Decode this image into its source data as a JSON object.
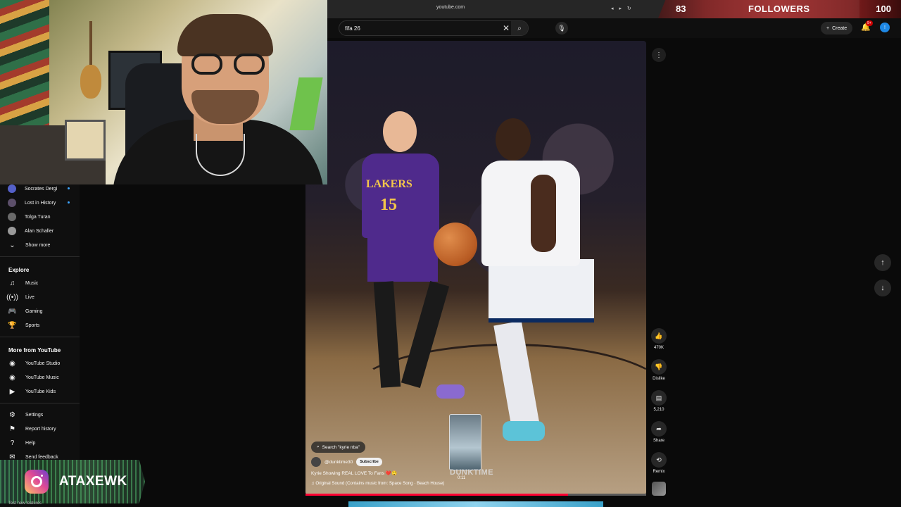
{
  "browser": {
    "url": "youtube.com"
  },
  "stream_overlay": {
    "followers_current": "83",
    "followers_label": "FOLLOWERS",
    "followers_goal": "100",
    "progress_fraction": 0.83,
    "instagram_handle": "ATAXEWK",
    "bottom_note": "Test new features"
  },
  "masthead": {
    "search_query": "fifa 26",
    "create_label": "Create",
    "notification_badge": "9+",
    "account_initial": "!"
  },
  "sidebar": {
    "subscriptions": [
      {
        "label": "Socrates Dergi",
        "new": true
      },
      {
        "label": "Lost in History",
        "new": true
      },
      {
        "label": "Tolga Turan",
        "new": false
      },
      {
        "label": "Alan Schaller",
        "new": false
      }
    ],
    "show_more": "Show more",
    "explore_heading": "Explore",
    "explore": [
      "Music",
      "Live",
      "Gaming",
      "Sports"
    ],
    "more_heading": "More from YouTube",
    "more": [
      "YouTube Studio",
      "YouTube Music",
      "YouTube Kids"
    ],
    "footer": [
      "Settings",
      "Report history",
      "Help",
      "Send feedback"
    ]
  },
  "short": {
    "search_chip": "Search \"kyrie nba\"",
    "channel": "@dunktime30",
    "subscribe_label": "Subscribe",
    "title": "Kyrie Showing REAL LOVE To Fans ❤️😲",
    "sound": "♫ Original Sound (Contains music from: Space Song · Beach House)",
    "jersey_text": "LAKERS",
    "jersey_number": "15",
    "preview_time": "0:11",
    "watermark": "DUNKTIME",
    "progress_fraction": 0.77
  },
  "actions": {
    "likes": "470K",
    "dislike": "Dislike",
    "comments": "5,210",
    "share": "Share",
    "remix": "Remix"
  },
  "colors": {
    "accent": "#ff0033",
    "link": "#3ea6ff",
    "counter": "#9e2b2b"
  }
}
